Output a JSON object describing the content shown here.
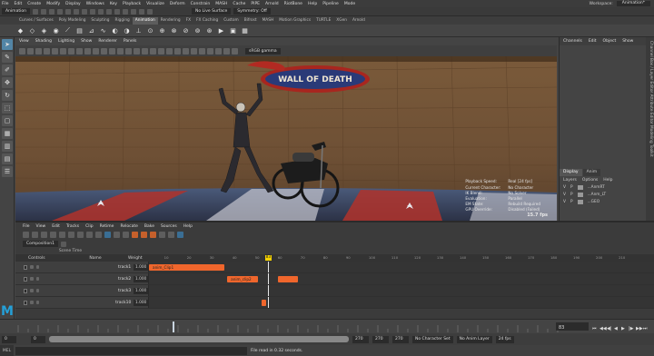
{
  "menubar": {
    "items": [
      "File",
      "Edit",
      "Create",
      "Modify",
      "Display",
      "Windows",
      "Key",
      "Playback",
      "Visualize",
      "Deform",
      "Constrain",
      "MASH",
      "Cache",
      "PIPE",
      "Arnold",
      "RiotBone",
      "Help",
      "Pipeline",
      "Mode"
    ],
    "workspace_label": "Workspace:",
    "workspace_value": "Animation*"
  },
  "status": {
    "menuset": "Animation",
    "live_surface": "No Live Surface",
    "symmetry": "Symmetry: Off"
  },
  "shelf_tabs": [
    "Curves / Surfaces",
    "Poly Modeling",
    "Sculpting",
    "Rigging",
    "Animation",
    "Rendering",
    "FX",
    "FX Caching",
    "Custom",
    "Bifrost",
    "MASH",
    "Motion Graphics",
    "TURTLE",
    "XGen",
    "Arnold"
  ],
  "active_shelf": "Animation",
  "viewport": {
    "menu": [
      "View",
      "Shading",
      "Lighting",
      "Show",
      "Renderer",
      "Panels"
    ],
    "color_space": "sRGB gamma",
    "banner_text": "WALL OF DEATH",
    "hud": [
      {
        "label": "Playback Speed:",
        "value": "Real [24 fps]"
      },
      {
        "label": "Current Character:",
        "value": "No Character"
      },
      {
        "label": "IK Blend:",
        "value": "No Solver"
      },
      {
        "label": "Evaluation:",
        "value": "Parallel"
      },
      {
        "label": "EM State:",
        "value": "Rebuild Required"
      },
      {
        "label": "GPU Override:",
        "value": "Disabled (Failed)"
      }
    ],
    "fps": "15.7 fps"
  },
  "channel_box": {
    "menu": [
      "Channels",
      "Edit",
      "Object",
      "Show"
    ]
  },
  "layer_editor": {
    "tabs": [
      "Display",
      "Anim"
    ],
    "active_tab": "Display",
    "menu": [
      "Layers",
      "Options",
      "Help"
    ],
    "layers": [
      {
        "v": "V",
        "p": "P",
        "name": "...AnmRT"
      },
      {
        "v": "V",
        "p": "P",
        "name": "...Anm_LT"
      },
      {
        "v": "V",
        "p": "P",
        "name": "...GEO"
      }
    ]
  },
  "side_tabs": "Channel Box / Layer Editor   Attribute Editor   Modeling Toolkit",
  "time_editor": {
    "menu": [
      "File",
      "View",
      "Edit",
      "Tracks",
      "Clip",
      "Retime",
      "Relocate",
      "Bake",
      "Sources",
      "Help"
    ],
    "composition": "Composition1",
    "scene_time_label": "Scene Time",
    "columns": {
      "controls": "Controls",
      "name": "Name",
      "weight": "Weight"
    },
    "playhead": "83",
    "ruler_ticks": [
      {
        "frame": "10",
        "pos": 0.03
      },
      {
        "frame": "20",
        "pos": 0.075
      },
      {
        "frame": "30",
        "pos": 0.12
      },
      {
        "frame": "40",
        "pos": 0.165
      },
      {
        "frame": "50",
        "pos": 0.21
      },
      {
        "frame": "60",
        "pos": 0.255
      },
      {
        "frame": "70",
        "pos": 0.3
      },
      {
        "frame": "80",
        "pos": 0.345
      },
      {
        "frame": "90",
        "pos": 0.39
      },
      {
        "frame": "100",
        "pos": 0.435
      },
      {
        "frame": "110",
        "pos": 0.48
      },
      {
        "frame": "120",
        "pos": 0.525
      },
      {
        "frame": "130",
        "pos": 0.57
      },
      {
        "frame": "140",
        "pos": 0.615
      },
      {
        "frame": "150",
        "pos": 0.66
      },
      {
        "frame": "160",
        "pos": 0.705
      },
      {
        "frame": "170",
        "pos": 0.75
      },
      {
        "frame": "180",
        "pos": 0.795
      },
      {
        "frame": "190",
        "pos": 0.84
      },
      {
        "frame": "200",
        "pos": 0.885
      },
      {
        "frame": "210",
        "pos": 0.93
      }
    ],
    "tracks": [
      {
        "name": "track1",
        "weight": "1.000",
        "clips": [
          {
            "label": "anim_Clip1",
            "start": 0.0,
            "end": 0.15
          }
        ]
      },
      {
        "name": "track2",
        "weight": "1.000",
        "clips": [
          {
            "label": "anim_clip2",
            "start": 0.155,
            "end": 0.215
          },
          {
            "label": "",
            "start": 0.255,
            "end": 0.295
          }
        ]
      },
      {
        "name": "track3",
        "weight": "1.000",
        "clips": []
      },
      {
        "name": "track10",
        "weight": "1.000",
        "clips": [
          {
            "label": "",
            "start": 0.223,
            "end": 0.232
          }
        ]
      }
    ]
  },
  "time_slider": {
    "current_frame": "83"
  },
  "range_slider": {
    "start": "0",
    "inner_start": "0",
    "inner_end": "270",
    "end_a": "270",
    "end_b": "270",
    "character": "No Character Set",
    "anim_layer": "No Anim Layer",
    "fps": "24 fps"
  },
  "help_line": {
    "mel": "MEL",
    "message": "File read in  0.32 seconds."
  }
}
